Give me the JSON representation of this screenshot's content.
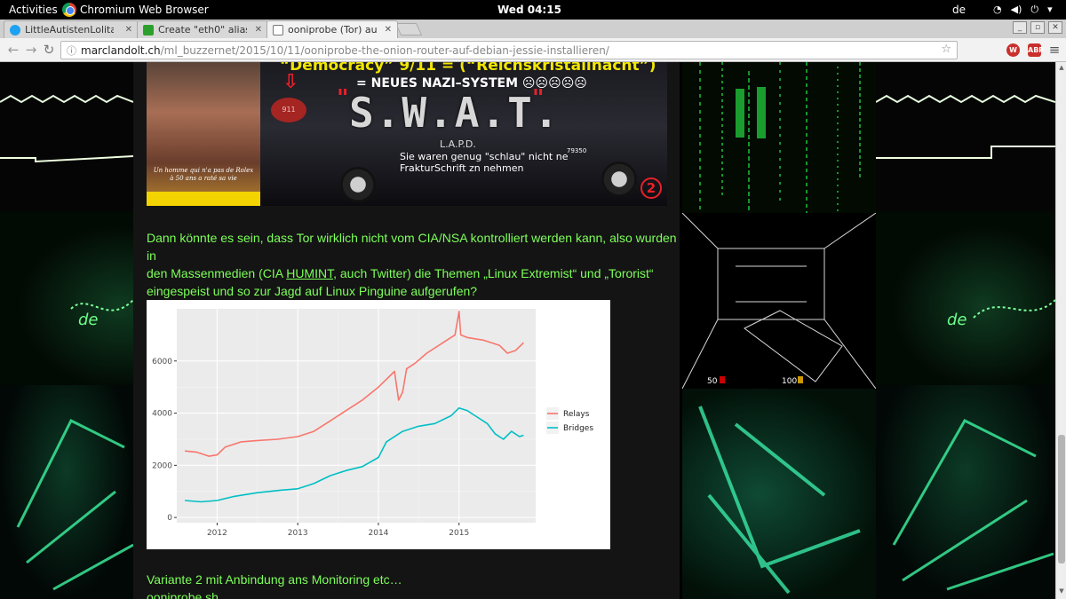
{
  "topbar": {
    "activities": "Activities",
    "app_name": "Chromium Web Browser",
    "clock": "Wed 04:15",
    "lang": "de"
  },
  "tabs": [
    {
      "title": "LittleAutistenLolita",
      "favicon": "twitter-icon",
      "color": "#1da1f2",
      "active": false
    },
    {
      "title": "Create \"eth0\" alias",
      "favicon": "stackexchange-icon",
      "color": "#2ca02c",
      "active": false
    },
    {
      "title": "ooniprobe (Tor) auf",
      "favicon": "page-icon",
      "color": "#ffffff",
      "active": true
    }
  ],
  "toolbar": {
    "url_host": "marclandolt.ch",
    "url_path": "/ml_buzzernet/2015/10/11/ooniprobe-the-onion-router-auf-debian-jessie-installieren/",
    "ext1": "W",
    "ext2": "ABP"
  },
  "banner": {
    "headline": "“Democracy” 9/11 = (“Reichskristallnacht”)",
    "subline": "= NEUES NAZI–SYSTEM ☹☹☹☹☹",
    "swat": "S.W.A.T.",
    "lapd": "L.A.P.D.",
    "note_line1": "Sie waren genug \"schlau\" nicht ne",
    "note_line2": "FrakturSchrift zn nehmen",
    "car_number": "79350",
    "circle_number": "2",
    "tag_911": "911",
    "caption": "Un homme qui n'a pas de Rolex à 50 ans a raté sa vie"
  },
  "article": {
    "para1_a": "Dann könnte es sein, dass Tor wirklich nicht vom CIA/NSA kontrolliert werden kann, also wurden in",
    "para1_b_pre": "den Massenmedien (CIA ",
    "para1_b_link": "HUMINT",
    "para1_b_post": ", auch Twitter) die Themen „Linux Extremist“ und „Tororist“",
    "para1_c": "eingespeist und so zur Jagd auf Linux Pinguine aufgerufen?",
    "para2": "Variante 2 mit Anbindung ans Monitoring etc…",
    "para3": "ooniprobe.sh"
  },
  "chart_data": {
    "type": "line",
    "title": "",
    "xlabel": "",
    "ylabel": "",
    "xlim": [
      2011.5,
      2015.95
    ],
    "ylim": [
      -200,
      8000
    ],
    "x_ticks": [
      2012,
      2013,
      2014,
      2015
    ],
    "y_ticks": [
      0,
      2000,
      4000,
      6000
    ],
    "legend_position": "right",
    "series": [
      {
        "name": "Relays",
        "color": "#f8766d",
        "x": [
          2011.6,
          2011.75,
          2011.9,
          2012.0,
          2012.1,
          2012.3,
          2012.5,
          2012.75,
          2013.0,
          2013.2,
          2013.4,
          2013.6,
          2013.8,
          2014.0,
          2014.1,
          2014.2,
          2014.25,
          2014.3,
          2014.35,
          2014.45,
          2014.6,
          2014.8,
          2014.95,
          2015.0,
          2015.02,
          2015.1,
          2015.3,
          2015.5,
          2015.6,
          2015.7,
          2015.8
        ],
        "y": [
          2550,
          2500,
          2350,
          2400,
          2700,
          2900,
          2950,
          3000,
          3100,
          3300,
          3700,
          4100,
          4500,
          5000,
          5300,
          5600,
          4500,
          4800,
          5700,
          5900,
          6300,
          6700,
          7000,
          7900,
          7000,
          6900,
          6800,
          6600,
          6300,
          6400,
          6700
        ]
      },
      {
        "name": "Bridges",
        "color": "#00bfc4",
        "x": [
          2011.6,
          2011.8,
          2012.0,
          2012.2,
          2012.5,
          2012.8,
          2013.0,
          2013.2,
          2013.4,
          2013.6,
          2013.8,
          2014.0,
          2014.1,
          2014.3,
          2014.5,
          2014.7,
          2014.9,
          2015.0,
          2015.1,
          2015.2,
          2015.35,
          2015.45,
          2015.55,
          2015.65,
          2015.75,
          2015.8
        ],
        "y": [
          650,
          600,
          650,
          800,
          950,
          1050,
          1100,
          1300,
          1600,
          1800,
          1950,
          2300,
          2900,
          3300,
          3500,
          3600,
          3900,
          4200,
          4100,
          3900,
          3600,
          3200,
          3000,
          3300,
          3100,
          3150
        ]
      }
    ]
  }
}
